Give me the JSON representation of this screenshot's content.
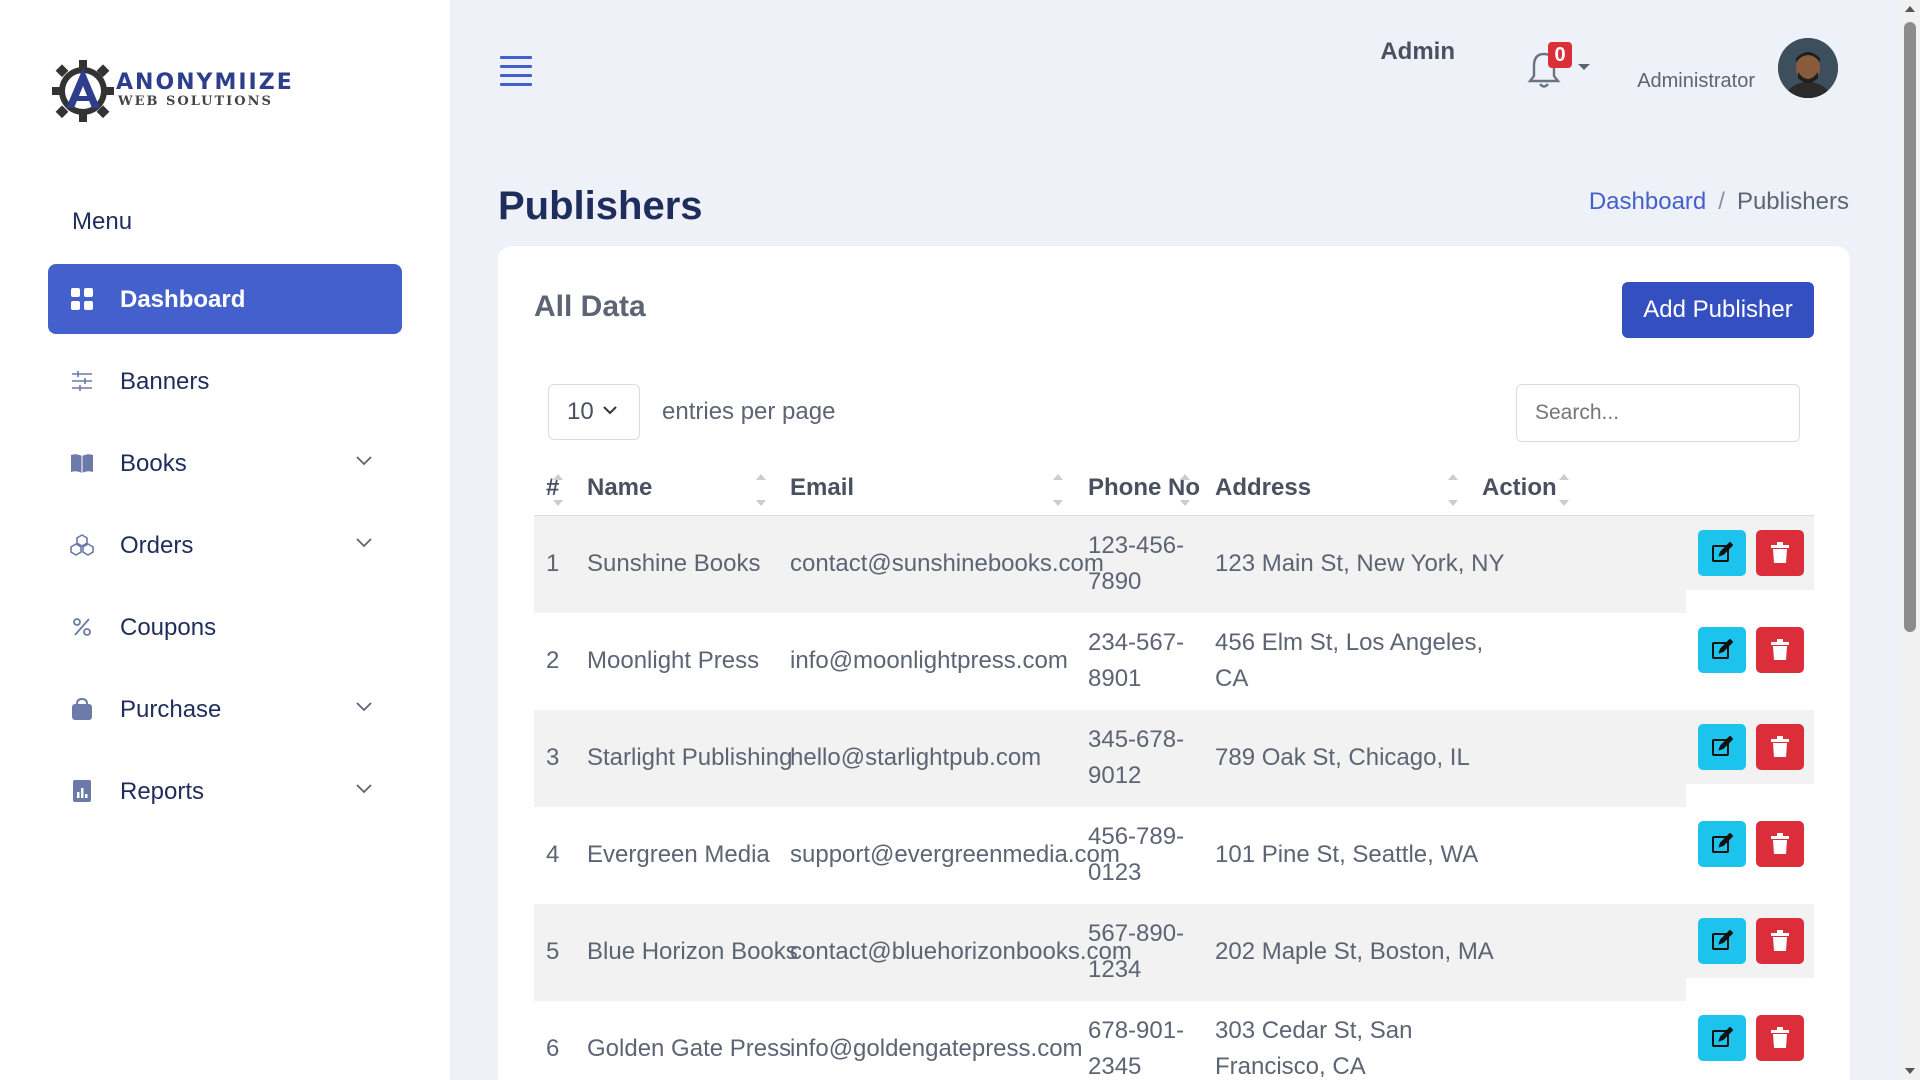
{
  "brand": {
    "name_line1": "ANONYMIIZE",
    "name_line2": "WEB SOLUTIONS",
    "logo_icon": "gear-a-logo"
  },
  "sidebar": {
    "menu_title": "Menu",
    "items": [
      {
        "label": "Dashboard",
        "icon": "grid-icon",
        "active": true,
        "has_submenu": false
      },
      {
        "label": "Banners",
        "icon": "sliders-icon",
        "active": false,
        "has_submenu": false
      },
      {
        "label": "Books",
        "icon": "book-icon",
        "active": false,
        "has_submenu": true
      },
      {
        "label": "Orders",
        "icon": "boxes-icon",
        "active": false,
        "has_submenu": true
      },
      {
        "label": "Coupons",
        "icon": "percent-icon",
        "active": false,
        "has_submenu": false
      },
      {
        "label": "Purchase",
        "icon": "bag-icon",
        "active": false,
        "has_submenu": true
      },
      {
        "label": "Reports",
        "icon": "report-icon",
        "active": false,
        "has_submenu": true
      }
    ]
  },
  "header": {
    "notification_count": "0",
    "user_name": "Admin",
    "user_role": "Administrator"
  },
  "page": {
    "title": "Publishers",
    "breadcrumb": {
      "home": "Dashboard",
      "separator": "/",
      "current": "Publishers"
    }
  },
  "card": {
    "title": "All Data",
    "add_button": "Add Publisher",
    "per_page_value": "10",
    "per_page_label": "entries per page",
    "search_placeholder": "Search..."
  },
  "table": {
    "headers": {
      "index": "#",
      "name": "Name",
      "email": "Email",
      "phone": "Phone No",
      "address": "Address",
      "action": "Action"
    },
    "rows": [
      {
        "index": "1",
        "name": "Sunshine Books",
        "email": "contact@sunshinebooks.com",
        "phone_1": "123-456-",
        "phone_2": "7890",
        "address_1": "123 Main St, New York, NY",
        "address_2": ""
      },
      {
        "index": "2",
        "name": "Moonlight Press",
        "email": "info@moonlightpress.com",
        "phone_1": "234-567-",
        "phone_2": "8901",
        "address_1": "456 Elm St, Los Angeles,",
        "address_2": "CA"
      },
      {
        "index": "3",
        "name": "Starlight Publishing",
        "email": "hello@starlightpub.com",
        "phone_1": "345-678-",
        "phone_2": "9012",
        "address_1": "789 Oak St, Chicago, IL",
        "address_2": ""
      },
      {
        "index": "4",
        "name": "Evergreen Media",
        "email": "support@evergreenmedia.com",
        "phone_1": "456-789-",
        "phone_2": "0123",
        "address_1": "101 Pine St, Seattle, WA",
        "address_2": ""
      },
      {
        "index": "5",
        "name": "Blue Horizon Books",
        "email": "contact@bluehorizonbooks.com",
        "phone_1": "567-890-",
        "phone_2": "1234",
        "address_1": "202 Maple St, Boston, MA",
        "address_2": ""
      },
      {
        "index": "6",
        "name": "Golden Gate Press",
        "email": "info@goldengatepress.com",
        "phone_1": "678-901-",
        "phone_2": "2345",
        "address_1": "303 Cedar St, San",
        "address_2": "Francisco, CA"
      }
    ]
  },
  "colors": {
    "primary": "#4360cc",
    "edit": "#1bc3ed",
    "delete": "#dc2d3a",
    "navy": "#1f2d5c"
  }
}
